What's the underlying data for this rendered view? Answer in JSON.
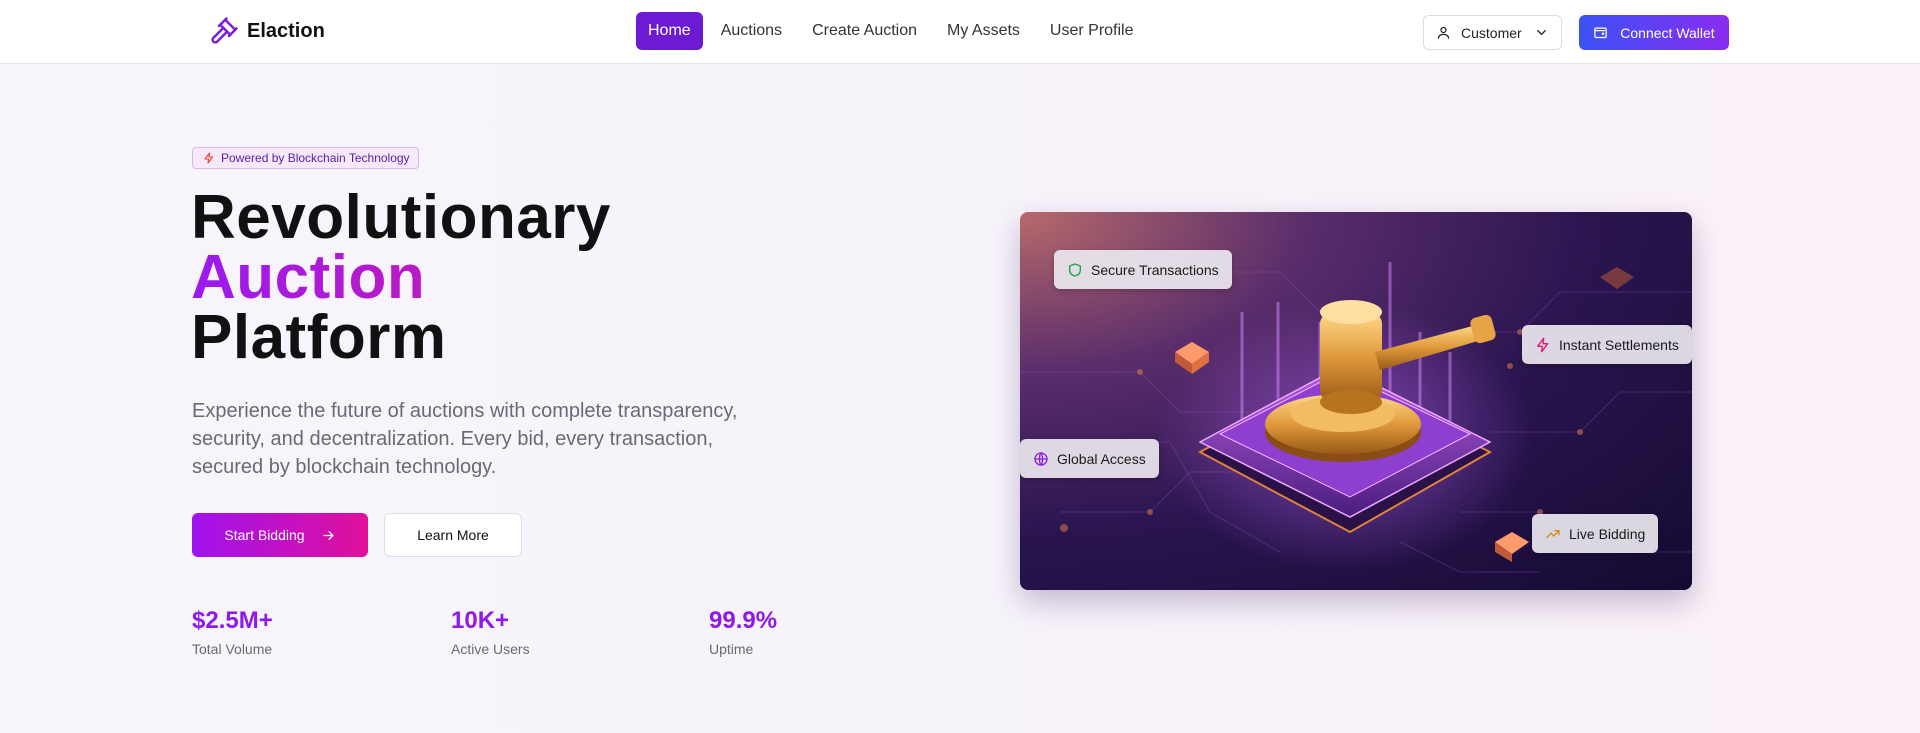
{
  "brand": {
    "name": "Elaction",
    "icon": "gavel-icon"
  },
  "nav": {
    "items": [
      {
        "label": "Home",
        "active": true
      },
      {
        "label": "Auctions"
      },
      {
        "label": "Create Auction"
      },
      {
        "label": "My Assets"
      },
      {
        "label": "User Profile"
      }
    ],
    "role_select": {
      "value": "Customer",
      "icon": "user-icon"
    },
    "wallet_button": {
      "label": "Connect Wallet",
      "icon": "wallet-icon"
    }
  },
  "hero": {
    "badge": {
      "label": "Powered by Blockchain Technology",
      "icon": "lightning-icon"
    },
    "headline": {
      "line1": "Revolutionary",
      "line2": "Auction",
      "line3": "Platform"
    },
    "lead": "Experience the future of auctions with complete transparency, security, and decentralization. Every bid, every transaction, secured by blockchain technology.",
    "primary_button": {
      "label": "Start Bidding",
      "icon": "arrow-right-icon"
    },
    "secondary_button": {
      "label": "Learn More"
    },
    "stats": [
      {
        "value": "$2.5M+",
        "label": "Total Volume"
      },
      {
        "value": "10K+",
        "label": "Active Users"
      },
      {
        "value": "99.9%",
        "label": "Uptime"
      }
    ],
    "chips": [
      {
        "label": "Secure Transactions",
        "icon": "shield-icon"
      },
      {
        "label": "Instant Settlements",
        "icon": "lightning-icon"
      },
      {
        "label": "Global Access",
        "icon": "globe-icon"
      },
      {
        "label": "Live Bidding",
        "icon": "trending-up-icon"
      }
    ]
  },
  "colors": {
    "accent": "#6d1ad3",
    "gradient_start": "#a012ee",
    "gradient_end": "#e0109a",
    "wallet_start": "#3b53f6",
    "wallet_end": "#8a2cf0",
    "stat": "#8f18ec"
  }
}
